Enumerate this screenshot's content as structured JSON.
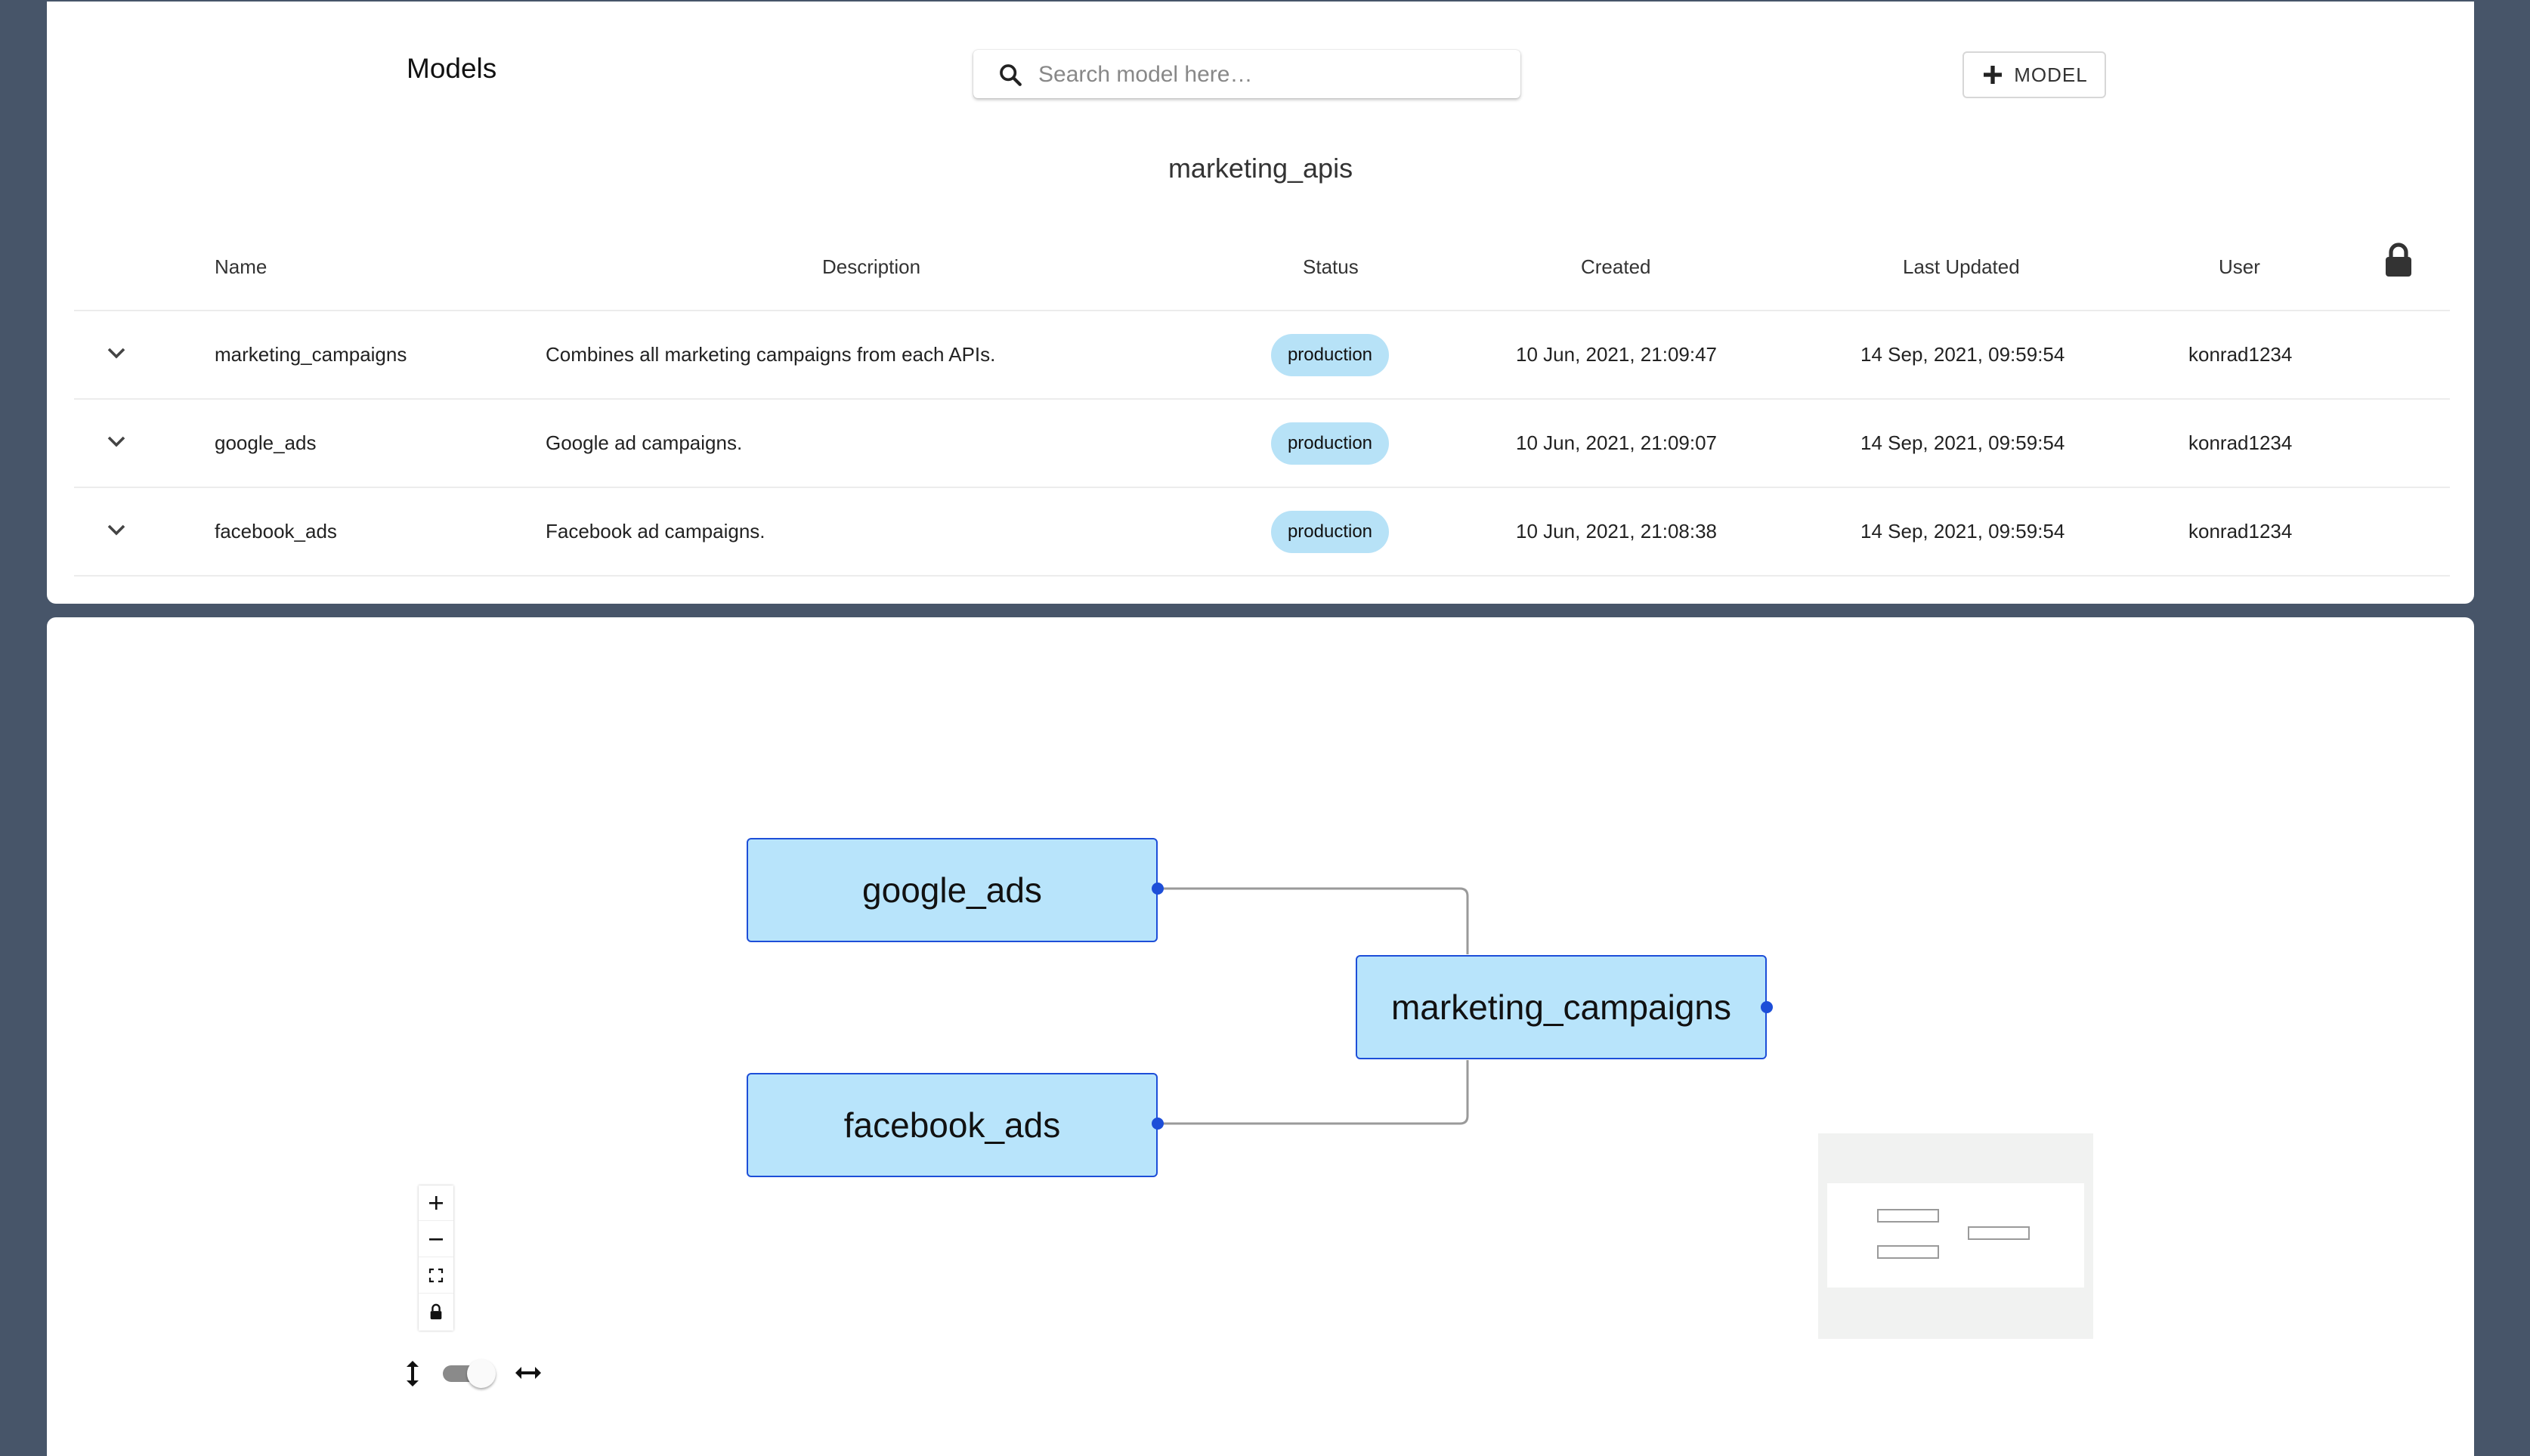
{
  "header": {
    "title": "Models",
    "search_placeholder": "Search model here…",
    "add_button_label": "MODEL",
    "project_name": "marketing_apis"
  },
  "table": {
    "columns": [
      "Name",
      "Description",
      "Status",
      "Created",
      "Last Updated",
      "User"
    ],
    "rows": [
      {
        "name": "marketing_campaigns",
        "description": "Combines all marketing campaigns from each APIs.",
        "status": "production",
        "created": "10 Jun, 2021, 21:09:47",
        "updated": "14 Sep, 2021, 09:59:54",
        "user": "konrad1234"
      },
      {
        "name": "google_ads",
        "description": "Google ad campaigns.",
        "status": "production",
        "created": "10 Jun, 2021, 21:09:07",
        "updated": "14 Sep, 2021, 09:59:54",
        "user": "konrad1234"
      },
      {
        "name": "facebook_ads",
        "description": "Facebook ad campaigns.",
        "status": "production",
        "created": "10 Jun, 2021, 21:08:38",
        "updated": "14 Sep, 2021, 09:59:54",
        "user": "konrad1234"
      }
    ]
  },
  "graph": {
    "nodes": {
      "google_ads": "google_ads",
      "facebook_ads": "facebook_ads",
      "marketing_campaigns": "marketing_campaigns"
    },
    "edges": [
      {
        "from": "google_ads",
        "to": "marketing_campaigns"
      },
      {
        "from": "facebook_ads",
        "to": "marketing_campaigns"
      }
    ],
    "controls": [
      "zoom-in",
      "zoom-out",
      "fit-view",
      "lock"
    ],
    "orientation_toggle": "horizontal"
  },
  "colors": {
    "background": "#475569",
    "badge": "#b7e2f7",
    "node_fill": "#b8e4fb",
    "node_border": "#1d4ed8"
  }
}
